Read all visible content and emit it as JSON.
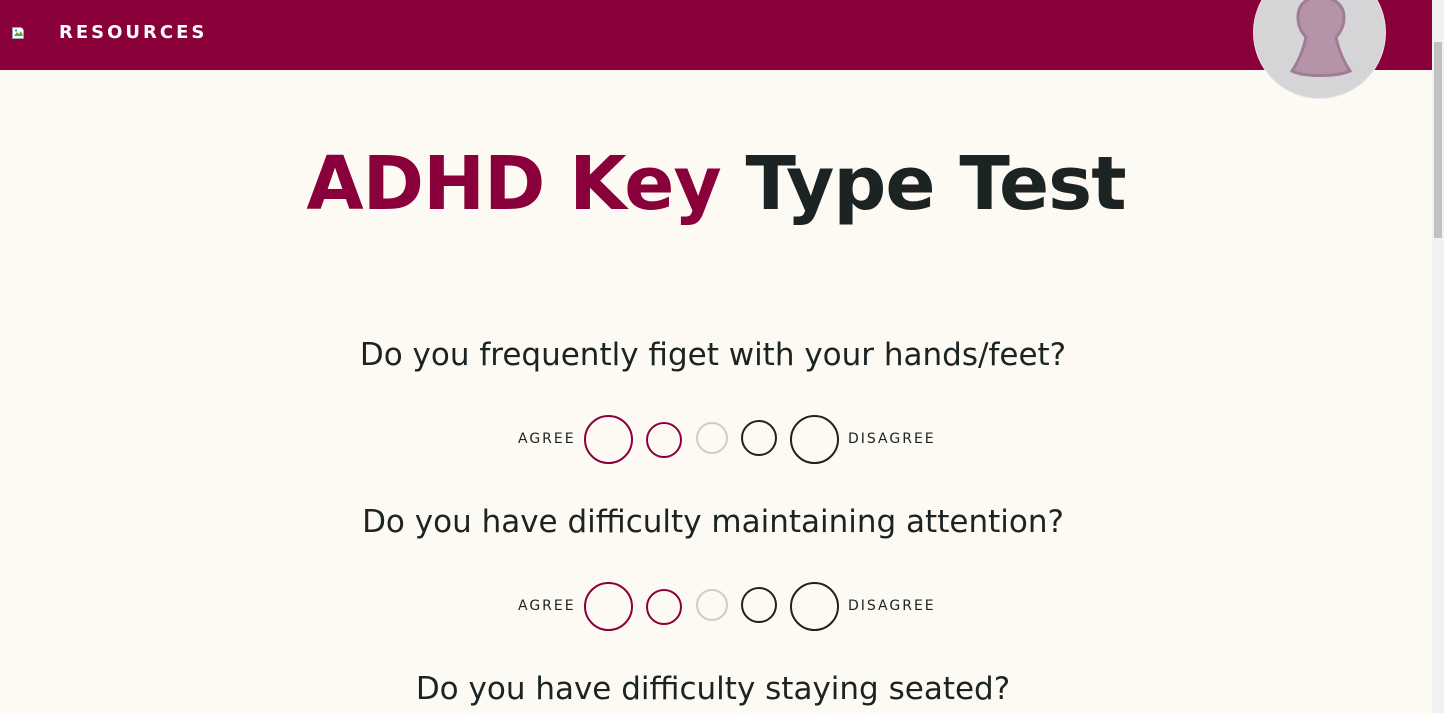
{
  "nav": {
    "resources_label": "RESOURCES"
  },
  "title": {
    "accent_text": "ADHD Key",
    "rest_text": "Type Test"
  },
  "questions": [
    {
      "text": "Do you frequently figet with your hands/feet?",
      "agree_label": "AGREE",
      "disagree_label": "DISAGREE"
    },
    {
      "text": "Do you have difficulty maintaining attention?",
      "agree_label": "AGREE",
      "disagree_label": "DISAGREE"
    },
    {
      "text": "Do you have difficulty staying seated?"
    }
  ],
  "colors": {
    "brand": "#8a003b",
    "background": "#fdfaf3",
    "text": "#1b2323",
    "neutral_option": "#cdcdcd"
  },
  "icons": {
    "avatar": "keyhole-avatar-icon",
    "nav_image": "broken-image-icon"
  }
}
